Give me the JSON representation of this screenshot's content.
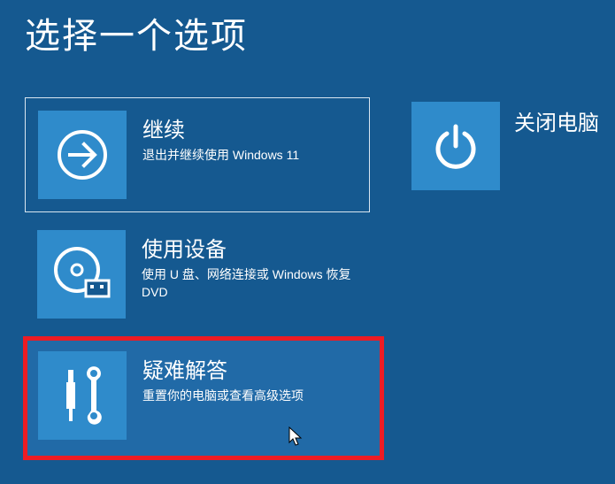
{
  "title": "选择一个选项",
  "tiles": {
    "continue": {
      "title": "继续",
      "desc": "退出并继续使用 Windows 11"
    },
    "device": {
      "title": "使用设备",
      "desc": "使用 U 盘、网络连接或 Windows 恢复 DVD"
    },
    "troubleshoot": {
      "title": "疑难解答",
      "desc": "重置你的电脑或查看高级选项"
    },
    "poweroff": {
      "title": "关闭电脑"
    }
  }
}
